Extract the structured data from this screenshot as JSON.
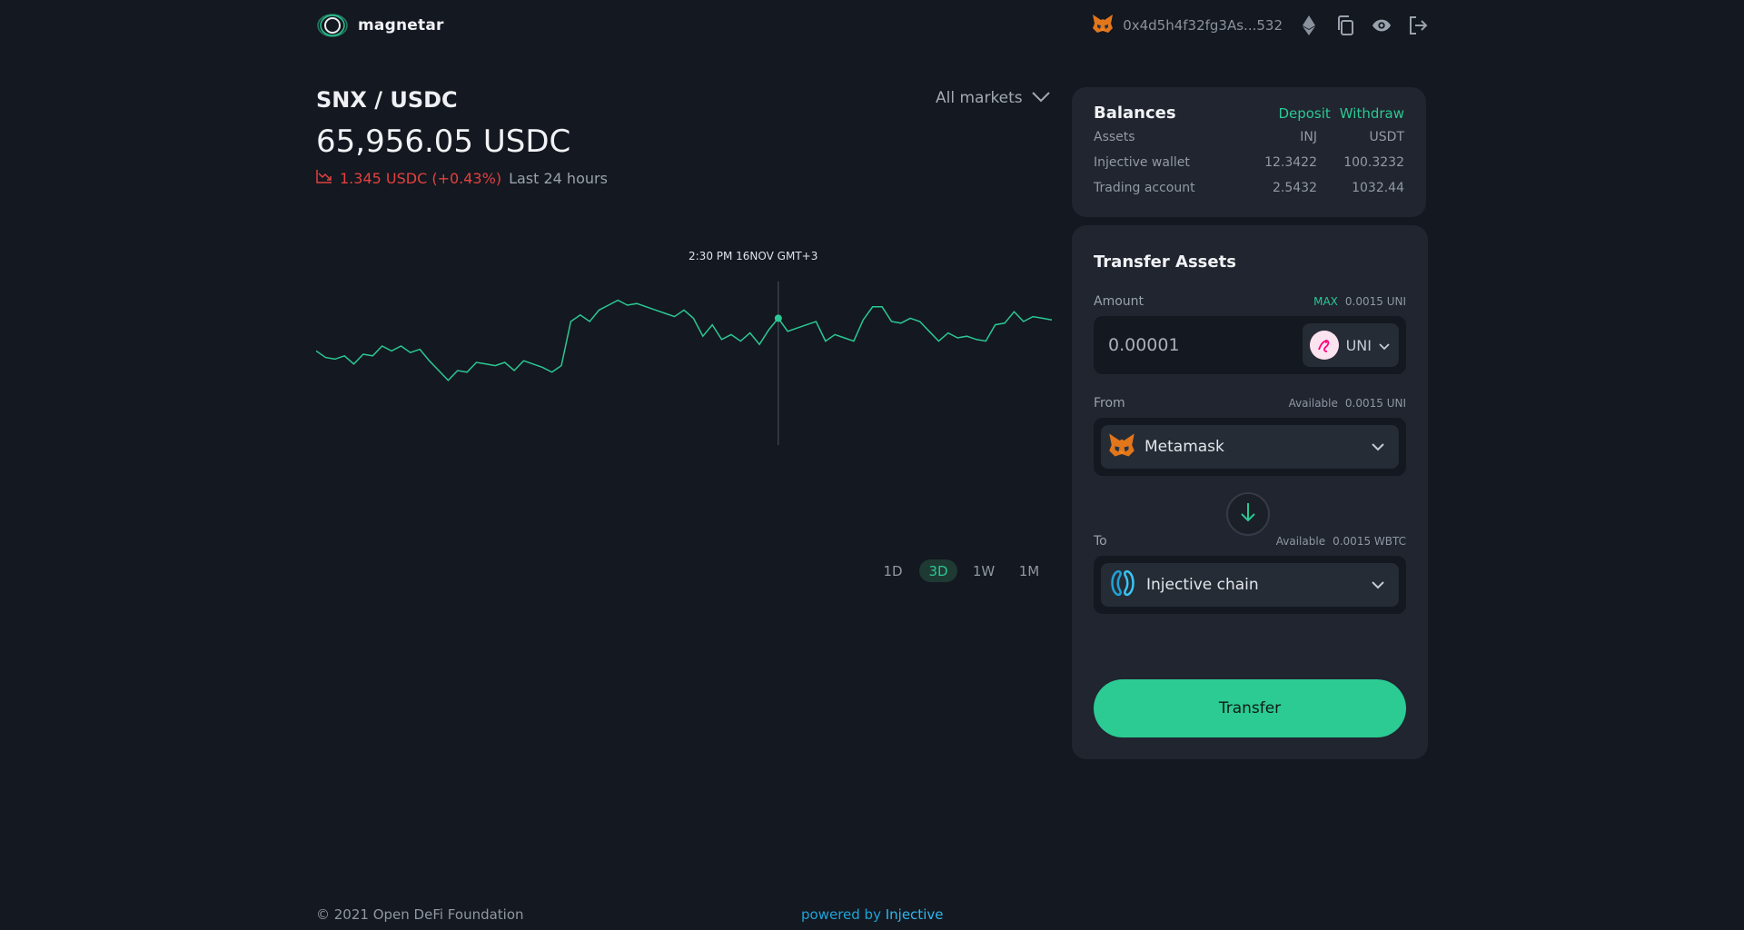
{
  "header": {
    "brand": "magnetar",
    "wallet_address": "0x4d5h4f32fg3As...532",
    "icons": [
      "metamask-fox-icon",
      "ethereum-icon",
      "copy-icon",
      "eye-icon",
      "logout-icon"
    ]
  },
  "market": {
    "pair": "SNX / USDC",
    "selector_label": "All markets",
    "price": "65,956.05 USDC",
    "change": "1.345 USDC (+0.43%)",
    "period": "Last 24 hours",
    "ranges": [
      "1D",
      "3D",
      "1W",
      "1M"
    ],
    "active_range": "3D"
  },
  "chart_data": {
    "type": "line",
    "tooltip": "2:30 PM 16NOV GMT+3",
    "series": [
      {
        "values": [
          52,
          48,
          47,
          49,
          44,
          50,
          49,
          55,
          52,
          55,
          51,
          53,
          46,
          40,
          34,
          40,
          39,
          45,
          44,
          43,
          45,
          40,
          46,
          44,
          42,
          39,
          43,
          70,
          74,
          70,
          77,
          80,
          83,
          80,
          81,
          79,
          77,
          75,
          73,
          77,
          72,
          61,
          68,
          59,
          62,
          58,
          63,
          56,
          65,
          72,
          64,
          66,
          68,
          70,
          58,
          62,
          60,
          58,
          71,
          79,
          79,
          70,
          69,
          72,
          70,
          64,
          58,
          63,
          60,
          61,
          59,
          58,
          68,
          69,
          76,
          70,
          73,
          72,
          71
        ]
      }
    ],
    "accent_color": "#2bc894"
  },
  "balances": {
    "title": "Balances",
    "deposit": "Deposit",
    "withdraw": "Withdraw",
    "header": {
      "asset": "Assets",
      "col1": "INJ",
      "col2": "USDT"
    },
    "rows": [
      {
        "name": "Injective wallet",
        "inj": "12.3422",
        "usdt": "100.3232"
      },
      {
        "name": "Trading account",
        "inj": "2.5432",
        "usdt": "1032.44"
      }
    ]
  },
  "transfer": {
    "title": "Transfer Assets",
    "amount_label": "Amount",
    "max_label": "MAX",
    "max_value": "0.0015 UNI",
    "amount_value": "0.00001",
    "token": "UNI",
    "from_label": "From",
    "from_available_label": "Available",
    "from_available_value": "0.0015 UNI",
    "from_value": "Metamask",
    "to_label": "To",
    "to_available_label": "Available",
    "to_available_value": "0.0015 WBTC",
    "to_value": "Injective chain",
    "button": "Transfer"
  },
  "footer": {
    "copyright": "© 2021 Open DeFi Foundation",
    "powered_prefix": "powered by",
    "powered_link": "Injective"
  },
  "colors": {
    "background": "#141820",
    "card": "#20252f",
    "accent": "#2bc894",
    "negative": "#e2413f"
  }
}
